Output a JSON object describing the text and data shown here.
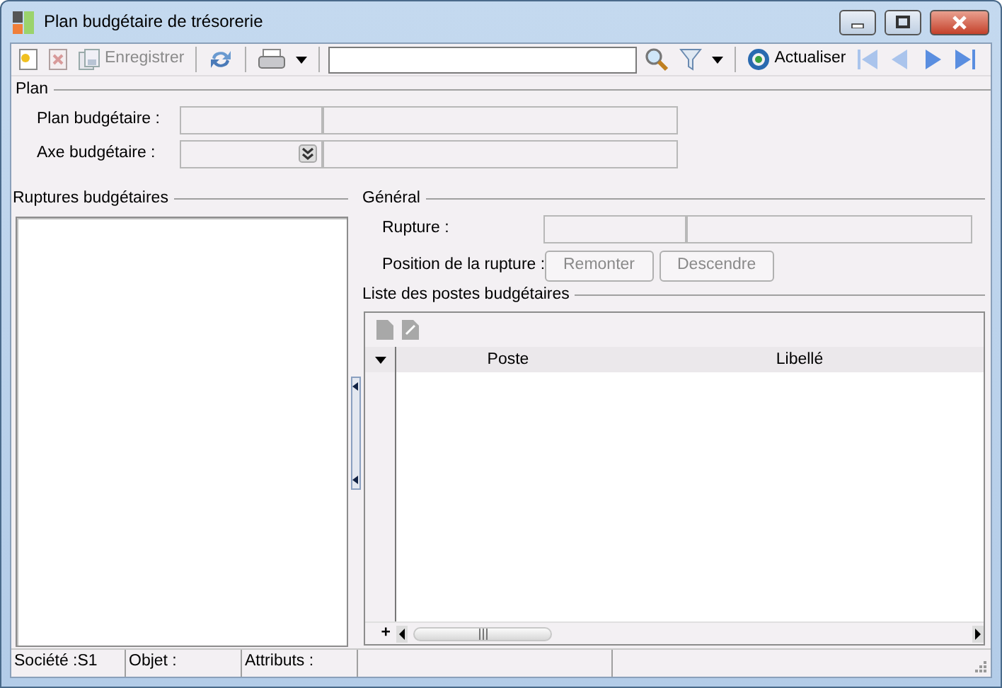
{
  "window": {
    "title": "Plan budgétaire de trésorerie"
  },
  "toolbar": {
    "new": {
      "disabled": false
    },
    "delete": {
      "disabled": true
    },
    "save": {
      "label": "Enregistrer",
      "disabled": true
    },
    "refresh_label": "Actualiser",
    "nav": [
      {
        "disabled": true
      },
      {
        "disabled": true
      },
      {
        "disabled": false
      },
      {
        "disabled": false
      }
    ]
  },
  "plan": {
    "title": "Plan",
    "fields": [
      {
        "label": "Plan budgétaire :",
        "kind": "text",
        "disabled": true
      },
      {
        "label": "Axe budgétaire :",
        "kind": "combo",
        "disabled": true
      }
    ]
  },
  "ruptures": {
    "title": "Ruptures budgétaires"
  },
  "general": {
    "title": "Général",
    "rupture_label": "Rupture :",
    "rupture_disabled": true,
    "position_label": "Position de la rupture :",
    "buttons": [
      {
        "label": "Remonter",
        "disabled": true
      },
      {
        "label": "Descendre",
        "disabled": true
      }
    ]
  },
  "postes": {
    "title": "Liste des postes budgétaires",
    "columns": [
      "Poste",
      "Libellé"
    ],
    "add_symbol": "+"
  },
  "status_bar": [
    "Société :S1",
    "Objet :",
    "Attributs :"
  ]
}
